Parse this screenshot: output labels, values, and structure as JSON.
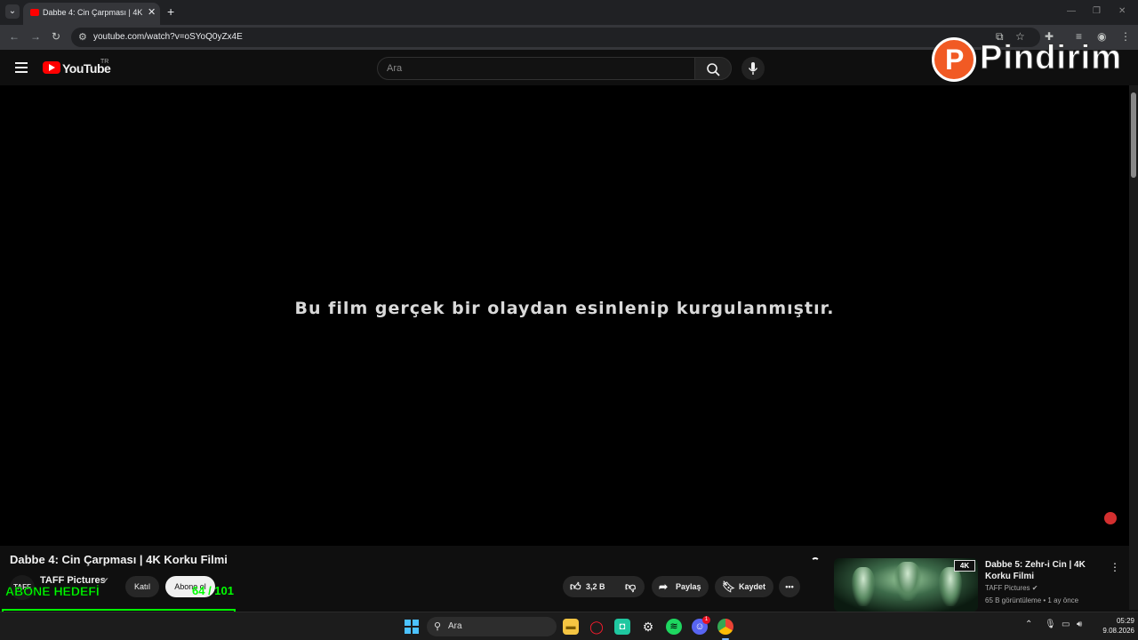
{
  "browser": {
    "tab_title": "Dabbe 4: Cin Çarpması | 4K Korku Filmi - YouTube",
    "new_tab_symbol": "+",
    "url": "youtube.com/watch?v=oSYoQ0yZx4E"
  },
  "youtube": {
    "logo_text": "YouTube",
    "country_code": "TR",
    "search_placeholder": "Ara"
  },
  "overlay": {
    "brand_letter": "P",
    "brand_name": "Pindirim"
  },
  "video": {
    "subtitle": "Bu film gerçek bir olaydan esinlenip kurgulanmıştır."
  },
  "details": {
    "title": "Dabbe 4: Cin Çarpması | 4K Korku Filmi",
    "channel_avatar_text": "TAFF",
    "channel_name": "TAFF Pictures",
    "join_label": "Katıl",
    "subscribe_label": "Abone ol",
    "like_count": "3,2 B",
    "share_label": "Paylaş",
    "save_label": "Kaydet"
  },
  "subscriber_goal": {
    "label": "ABONE HEDEFİ",
    "count_text": "64 / 101",
    "current": 64,
    "target": 101
  },
  "related": {
    "badge": "4K",
    "title": "Dabbe 5: Zehr-i Cin | 4K Korku Filmi",
    "channel": "TAFF Pictures",
    "meta": "65 B görüntüleme • 1 ay önce"
  },
  "taskbar": {
    "search_label": "Ara",
    "time": "05:29",
    "date": "9.08.2026",
    "discord_badge": "1"
  },
  "colors": {
    "youtube_red": "#ff0000",
    "goal_green": "#00ff00",
    "brand_orange": "#f15a24"
  }
}
